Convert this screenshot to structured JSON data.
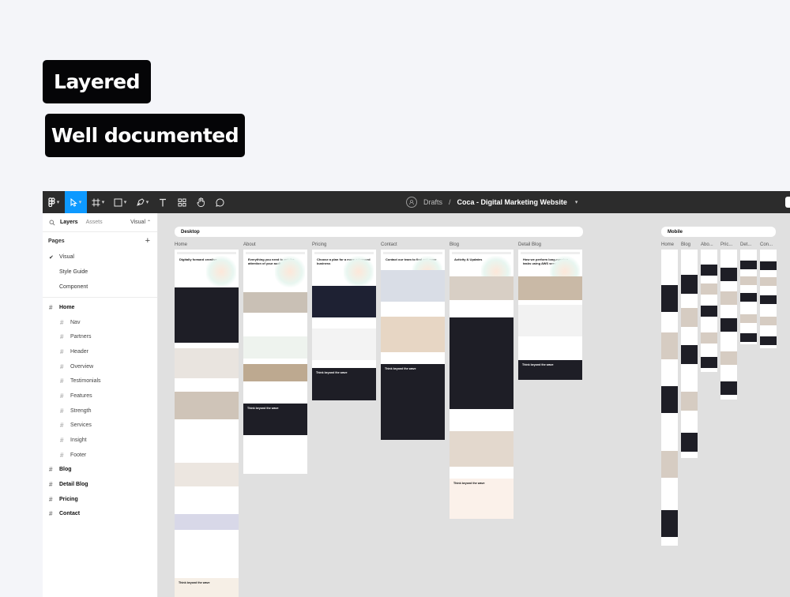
{
  "badges": {
    "layered": "Layered",
    "documented": "Well documented"
  },
  "toolbar": {
    "breadcrumb_location": "Drafts",
    "breadcrumb_separator": "/",
    "file_title": "Coca - Digital Marketing Website",
    "active_tool": "move-tool",
    "accent": "#0d99ff"
  },
  "panel": {
    "tab_layers": "Layers",
    "tab_assets": "Assets",
    "page_selector": "Visual",
    "pages_heading": "Pages",
    "pages": [
      "Visual",
      "Style Guide",
      "Component"
    ],
    "selected_page": "Visual",
    "layers": [
      {
        "label": "Home",
        "level": 0
      },
      {
        "label": "Nav",
        "level": 1
      },
      {
        "label": "Partners",
        "level": 1
      },
      {
        "label": "Header",
        "level": 1
      },
      {
        "label": "Overview",
        "level": 1
      },
      {
        "label": "Testimonials",
        "level": 1
      },
      {
        "label": "Features",
        "level": 1
      },
      {
        "label": "Strength",
        "level": 1
      },
      {
        "label": "Services",
        "level": 1
      },
      {
        "label": "Insight",
        "level": 1
      },
      {
        "label": "Footer",
        "level": 1
      },
      {
        "label": "Blog",
        "level": 0
      },
      {
        "label": "Detail Blog",
        "level": 0
      },
      {
        "label": "Pricing",
        "level": 0
      },
      {
        "label": "Contact",
        "level": 0
      }
    ]
  },
  "canvas": {
    "desktop_section": "Desktop",
    "mobile_section": "Mobile",
    "desktop_frames": [
      "Home",
      "About",
      "Pricing",
      "Contact",
      "Blog",
      "Detail Blog"
    ],
    "mobile_frames": [
      "Home",
      "Blog",
      "Abo...",
      "Pric...",
      "Det...",
      "Con..."
    ],
    "frame_text": {
      "home_hero": "Digitally forward creative",
      "about_hero": "Everything you need to get the attention of your audience",
      "pricing_hero": "Choose a plan for a more advanced business",
      "contact_hero": "Contact our team to find out more",
      "blog_hero": "Activity & Updates",
      "detail_hero": "How we perform long-running tasks using AWS services",
      "cta": "Think beyond the wave"
    }
  }
}
